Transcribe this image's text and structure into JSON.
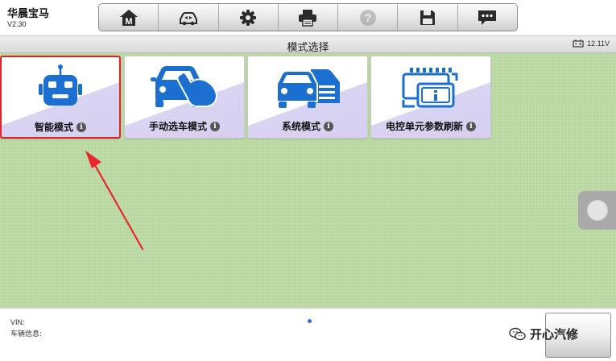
{
  "header": {
    "app_name": "华晨宝马",
    "version": "V2.30"
  },
  "toolbar": {
    "buttons": [
      {
        "icon": "home-icon",
        "label": "M"
      },
      {
        "icon": "car-swap-icon"
      },
      {
        "icon": "gear-icon"
      },
      {
        "icon": "printer-icon"
      },
      {
        "icon": "help-icon",
        "label": "?",
        "disabled": true
      },
      {
        "icon": "save-icon"
      },
      {
        "icon": "message-icon"
      }
    ]
  },
  "title_bar": {
    "title": "模式选择",
    "battery_voltage": "12.11V"
  },
  "modes": [
    {
      "label": "智能模式",
      "icon": "robot-icon",
      "selected": true
    },
    {
      "label": "手动选车模式",
      "icon": "hand-car-icon",
      "selected": false
    },
    {
      "label": "系统模式",
      "icon": "car-system-icon",
      "selected": false
    },
    {
      "label": "电控单元参数刷新",
      "icon": "ecu-refresh-icon",
      "selected": false
    }
  ],
  "info_glyph": "i",
  "footer": {
    "vin_label": "VIN:",
    "vehicle_info_label": "车辆信息:",
    "watermark": "开心汽修"
  },
  "colors": {
    "selection": "#e0232a",
    "icon_blue": "#1a6fd0",
    "background_green": "#b7d79f"
  }
}
